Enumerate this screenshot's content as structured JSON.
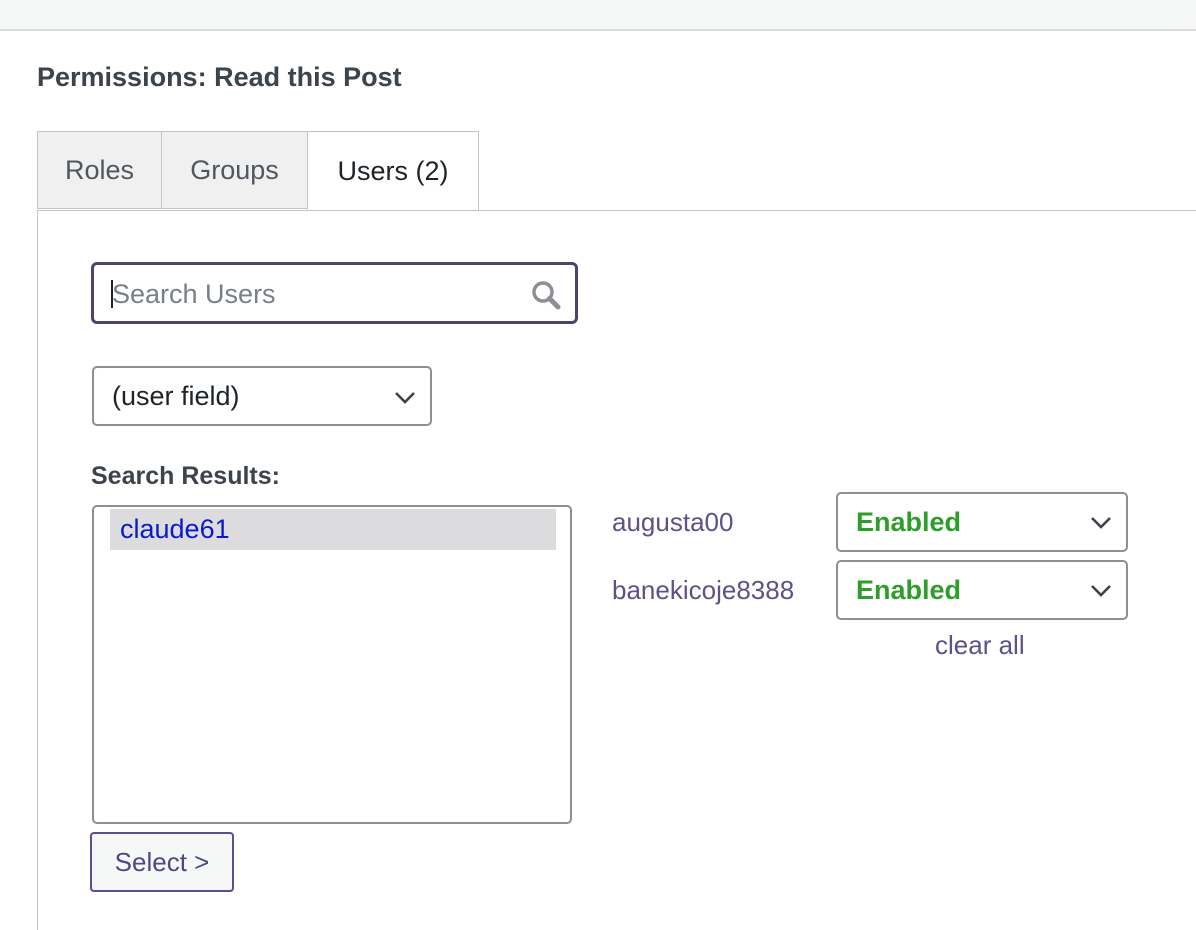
{
  "page": {
    "title": "Permissions: Read this Post"
  },
  "tabs": [
    {
      "label": "Roles"
    },
    {
      "label": "Groups"
    },
    {
      "label": "Users (2)"
    }
  ],
  "search": {
    "placeholder": "Search Users",
    "value": ""
  },
  "field_select": {
    "selected": "(user field)"
  },
  "results": {
    "label": "Search Results:",
    "items": [
      {
        "name": "claude61"
      }
    ]
  },
  "select_button": {
    "label": "Select >"
  },
  "assigned_users": [
    {
      "name": "augusta00",
      "status": "Enabled"
    },
    {
      "name": "banekicoje8388",
      "status": "Enabled"
    }
  ],
  "clear_all_label": "clear all",
  "colors": {
    "enabled": "#2e9e2a",
    "link": "#5b5287",
    "focus_border": "#4a4470"
  }
}
